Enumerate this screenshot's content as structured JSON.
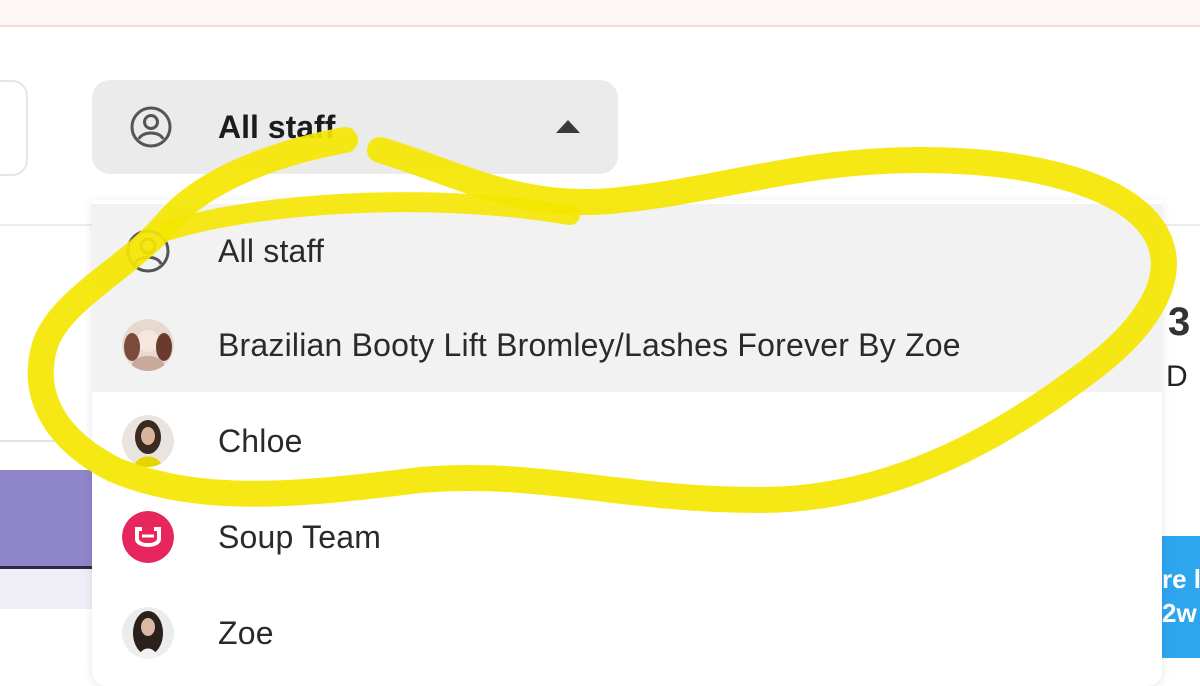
{
  "staff_filter": {
    "selected_label": "All staff",
    "trigger_icon": "person-circle-icon",
    "caret_icon": "caret-up-icon"
  },
  "staff_menu": {
    "items": [
      {
        "label": "All staff",
        "icon": "person-circle-icon",
        "highlighted": true
      },
      {
        "label": "Brazilian Booty Lift Bromley/Lashes Forever By Zoe",
        "icon": "avatar-photo",
        "highlighted": true
      },
      {
        "label": "Chloe",
        "icon": "avatar-photo",
        "highlighted": false
      },
      {
        "label": "Soup Team",
        "icon": "soup-logo-icon",
        "highlighted": false
      },
      {
        "label": "Zoe",
        "icon": "avatar-photo",
        "highlighted": false
      }
    ]
  },
  "background": {
    "right_edge_glyph": "3",
    "right_edge_letter": "D",
    "promo_line_1": "re l",
    "promo_line_2": "2w"
  },
  "colors": {
    "highlight_marker": "#f5e600",
    "trigger_bg": "#ebebeb",
    "soup_logo": "#e8265e",
    "promo_blue": "#2ea5ef",
    "purple_block": "#8f86c9"
  }
}
